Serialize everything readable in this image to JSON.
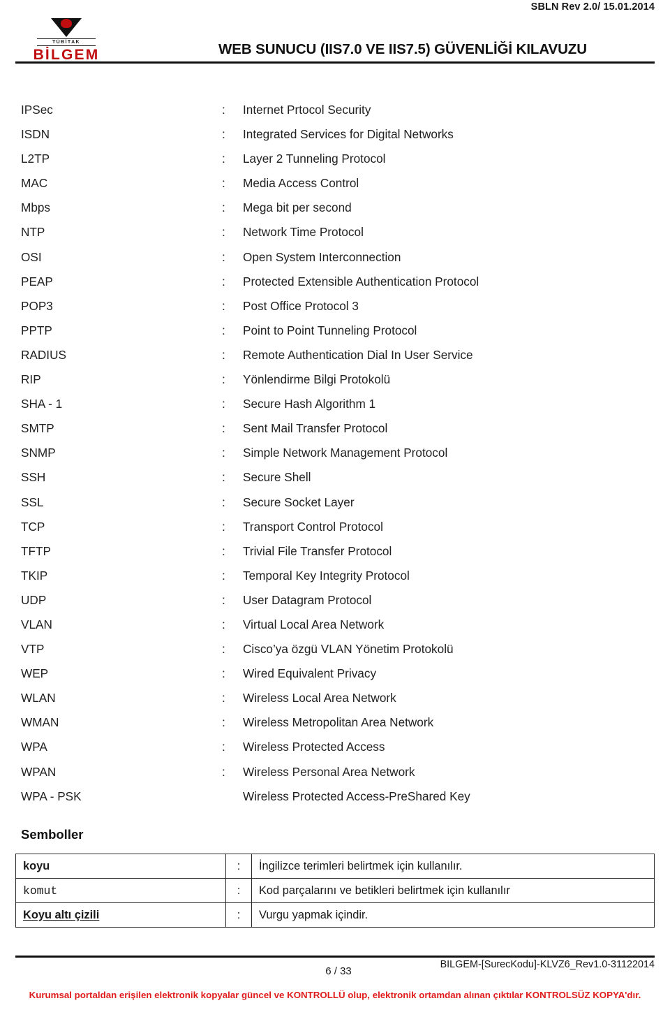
{
  "header": {
    "revision": "SBLN Rev 2.0/ 15.01.2014",
    "title": "WEB SUNUCU (IIS7.0 VE IIS7.5) GÜVENLİĞİ KILAVUZU",
    "logo": {
      "institute": "TÜBİTAK",
      "brand": "BİLGEM"
    },
    "accent_color": "#c00d10"
  },
  "abbreviations": {
    "separator": ":",
    "items": [
      {
        "term": "IPSec",
        "colon": ":",
        "definition": "Internet Prtocol Security"
      },
      {
        "term": "ISDN",
        "colon": ":",
        "definition": "Integrated Services for Digital Networks"
      },
      {
        "term": "L2TP",
        "colon": ":",
        "definition": "Layer 2 Tunneling Protocol"
      },
      {
        "term": "MAC",
        "colon": ":",
        "definition": "Media Access Control"
      },
      {
        "term": "Mbps",
        "colon": ":",
        "definition": "Mega bit per second"
      },
      {
        "term": "NTP",
        "colon": ":",
        "definition": "Network Time Protocol"
      },
      {
        "term": "OSI",
        "colon": ":",
        "definition": "Open System Interconnection"
      },
      {
        "term": "PEAP",
        "colon": ":",
        "definition": "Protected Extensible Authentication Protocol"
      },
      {
        "term": "POP3",
        "colon": ":",
        "definition": "Post Office Protocol 3"
      },
      {
        "term": "PPTP",
        "colon": ":",
        "definition": "Point to Point Tunneling Protocol"
      },
      {
        "term": "RADIUS",
        "colon": ":",
        "definition": "Remote Authentication Dial In User Service"
      },
      {
        "term": "RIP",
        "colon": ":",
        "definition": "Yönlendirme Bilgi Protokolü"
      },
      {
        "term": "SHA - 1",
        "colon": ":",
        "definition": "Secure Hash Algorithm 1"
      },
      {
        "term": "SMTP",
        "colon": ":",
        "definition": "Sent Mail Transfer Protocol"
      },
      {
        "term": "SNMP",
        "colon": ":",
        "definition": "Simple Network Management Protocol"
      },
      {
        "term": "SSH",
        "colon": ":",
        "definition": "Secure Shell"
      },
      {
        "term": "SSL",
        "colon": ":",
        "definition": "Secure Socket Layer"
      },
      {
        "term": "TCP",
        "colon": ":",
        "definition": "Transport Control Protocol"
      },
      {
        "term": "TFTP",
        "colon": ":",
        "definition": "Trivial File Transfer Protocol"
      },
      {
        "term": "TKIP",
        "colon": ":",
        "definition": "Temporal Key Integrity Protocol"
      },
      {
        "term": "UDP",
        "colon": ":",
        "definition": "User Datagram Protocol"
      },
      {
        "term": "VLAN",
        "colon": ":",
        "definition": "Virtual Local Area Network"
      },
      {
        "term": "VTP",
        "colon": ":",
        "definition": "Cisco’ya özgü VLAN Yönetim Protokolü"
      },
      {
        "term": "WEP",
        "colon": ":",
        "definition": "Wired Equivalent Privacy"
      },
      {
        "term": "WLAN",
        "colon": ":",
        "definition": "Wireless Local Area Network"
      },
      {
        "term": "WMAN",
        "colon": ":",
        "definition": "Wireless Metropolitan Area Network"
      },
      {
        "term": "WPA",
        "colon": ":",
        "definition": "Wireless Protected Access"
      },
      {
        "term": "WPAN",
        "colon": ":",
        "definition": "Wireless Personal Area Network"
      },
      {
        "term": "WPA - PSK",
        "colon": "",
        "definition": "Wireless Protected Access-PreShared Key"
      }
    ]
  },
  "symbols": {
    "heading": "Semboller",
    "rows": [
      {
        "key": "koyu",
        "colon": ":",
        "meaning": "İngilizce terimleri belirtmek için kullanılır.",
        "style": "bold"
      },
      {
        "key": "komut",
        "colon": ":",
        "meaning": "Kod parçalarını ve betikleri belirtmek için kullanılır",
        "style": "mono"
      },
      {
        "key": "Koyu altı çizili",
        "colon": ":",
        "meaning": "Vurgu yapmak içindir.",
        "style": "bold-underline"
      }
    ]
  },
  "footer": {
    "page": "6 / 33",
    "document_code": "BILGEM-[SurecKodu]-KLVZ6_Rev1.0-31122014",
    "notice": "Kurumsal portaldan erişilen elektronik kopyalar güncel ve KONTROLLÜ olup, elektronik ortamdan alınan çıktılar KONTROLSÜZ KOPYA'dır.",
    "notice_color": "#e01b1b"
  }
}
